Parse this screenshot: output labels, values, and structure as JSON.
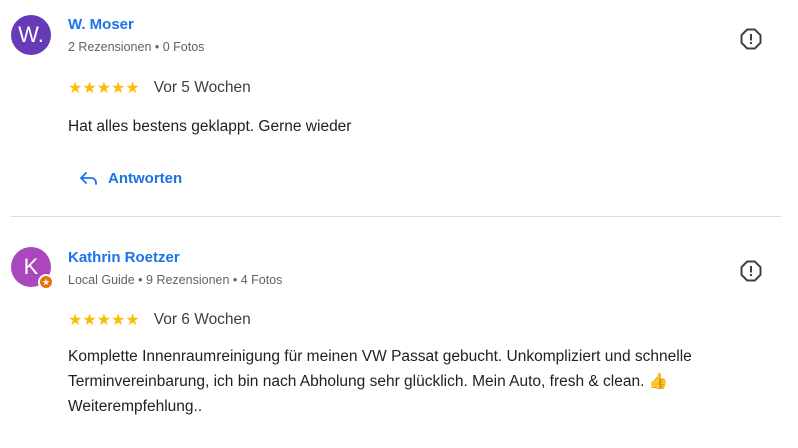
{
  "reviews": [
    {
      "avatar_letter": "W.",
      "avatar_color": "#673ab7",
      "name": "W. Moser",
      "meta": "2 Rezensionen • 0 Fotos",
      "stars": "★★★★★",
      "rating": 5,
      "time": "Vor 5 Wochen",
      "text": "Hat alles bestens geklappt. Gerne wieder",
      "reply_label": "Antworten",
      "local_guide": false
    },
    {
      "avatar_letter": "K",
      "avatar_color": "#ab47bc",
      "name": "Kathrin Roetzer",
      "meta": "Local Guide • 9 Rezensionen • 4 Fotos",
      "stars": "★★★★★",
      "rating": 5,
      "time": "Vor 6 Wochen",
      "text": "Komplette Innenraumreinigung für meinen VW Passat gebucht. Unkompliziert und schnelle Terminvereinbarung, ich bin nach Abholung sehr glücklich. Mein Auto, fresh & clean. 👍 Weiterempfehlung..",
      "local_guide": true
    }
  ],
  "icons": {
    "flag": "report-flag-icon",
    "reply": "reply-arrow-icon",
    "guide": "local-guide-badge-icon"
  },
  "colors": {
    "link": "#1a73e8",
    "star": "#fbbc04",
    "guide_badge": "#e8710a"
  }
}
